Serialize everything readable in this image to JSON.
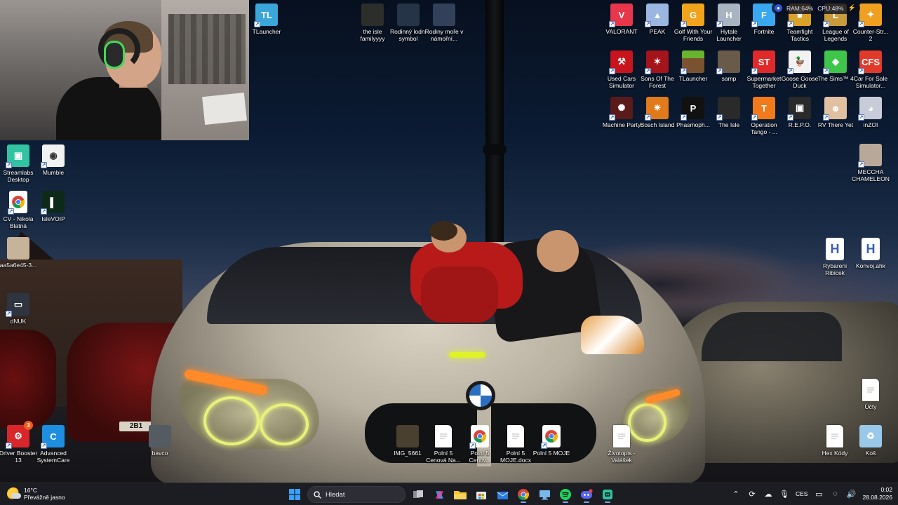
{
  "desktop": {
    "left_icons": [
      {
        "label": "Streamlabs Desktop",
        "icon": "streamlabs-icon",
        "color": "#31c3a2"
      },
      {
        "label": "Mumble",
        "icon": "mumble-icon",
        "color": "#f2f2f2"
      },
      {
        "label": "CV - Nikola Blatná",
        "icon": "chrome-icon",
        "color": "#ffffff"
      },
      {
        "label": "IsleVOIP",
        "icon": "islevoip-icon",
        "color": "#0d2a18"
      },
      {
        "label": "aa5a6e45-3...",
        "icon": "image-file-icon",
        "color": "#c7b39a"
      },
      {
        "label": "dNUK",
        "icon": "dnuk-icon",
        "color": "#2e3440"
      },
      {
        "label": "Driver Booster 13",
        "icon": "driver-booster-icon",
        "color": "#d8262b",
        "badge": "3"
      },
      {
        "label": "Advanced SystemCare",
        "icon": "advanced-systemcare-icon",
        "color": "#1e8fe0"
      },
      {
        "label": "bavco",
        "icon": "image-file-icon",
        "color": "#555b63"
      }
    ],
    "top_icons": [
      {
        "label": "TLauncher",
        "icon": "tlauncher-icon",
        "color": "#3aa6d9"
      },
      {
        "label": "the isle familyyyy",
        "icon": "the-isle-image-icon",
        "color": "#2b2e2a"
      },
      {
        "label": "Rodinný lodní symbol",
        "icon": "image-file-icon",
        "color": "#263448"
      },
      {
        "label": "Rodiny moře v námořní...",
        "icon": "image-file-icon",
        "color": "#32405a"
      }
    ],
    "right_icons": [
      {
        "label": "VALORANT",
        "icon": "valorant-icon",
        "color": "#e8374a"
      },
      {
        "label": "PEAK",
        "icon": "peak-icon",
        "color": "#9bb6e0"
      },
      {
        "label": "Golf With Your Friends",
        "icon": "golf-icon",
        "color": "#f2a31c"
      },
      {
        "label": "Hytale Launcher",
        "icon": "hytale-icon",
        "color": "#a8b5c0"
      },
      {
        "label": "Fortnite",
        "icon": "fortnite-icon",
        "color": "#38a8f0"
      },
      {
        "label": "Teamfight Tactics",
        "icon": "tft-icon",
        "color": "#d9a22a"
      },
      {
        "label": "League of Legends",
        "icon": "lol-icon",
        "color": "#c89b3c"
      },
      {
        "label": "Counter-Str... 2",
        "icon": "cs2-icon",
        "color": "#f0a020"
      },
      {
        "label": "Used Cars Simulator",
        "icon": "used-cars-icon",
        "color": "#c8141c"
      },
      {
        "label": "Sons Of The Forest",
        "icon": "sons-forest-icon",
        "color": "#a5141a"
      },
      {
        "label": "TLauncher",
        "icon": "minecraft-block-icon",
        "color": "#5a9a2a"
      },
      {
        "label": "samp",
        "icon": "samp-icon",
        "color": "#6a5a4a"
      },
      {
        "label": "Supermarket Together",
        "icon": "supermarket-icon",
        "color": "#e02a2a"
      },
      {
        "label": "Goose Goose Duck",
        "icon": "goose-icon",
        "color": "#f2f2f2"
      },
      {
        "label": "The Sims™ 4",
        "icon": "sims-icon",
        "color": "#3ec54a"
      },
      {
        "label": "Car For Sale Simulator...",
        "icon": "car-for-sale-icon",
        "color": "#e23a2a"
      },
      {
        "label": "Machine Party",
        "icon": "machine-party-icon",
        "color": "#5a1a1a"
      },
      {
        "label": "Bosch Island",
        "icon": "bosch-island-icon",
        "color": "#e07a1a"
      },
      {
        "label": "Phasmoph...",
        "icon": "phasmophobia-icon",
        "color": "#111111"
      },
      {
        "label": "The Isle",
        "icon": "the-isle-icon",
        "color": "#2a2a2a"
      },
      {
        "label": "Operation Tango - ...",
        "icon": "operation-tango-icon",
        "color": "#f27a1a"
      },
      {
        "label": "R.E.P.O.",
        "icon": "repo-icon",
        "color": "#2a2a2a"
      },
      {
        "label": "RV There Yet",
        "icon": "rv-there-yet-icon",
        "color": "#e0c0a0"
      },
      {
        "label": "inZOI",
        "icon": "inzoi-icon",
        "color": "#c8ccd8"
      },
      {
        "label": "MECCHA CHAMELEON",
        "icon": "meccha-chameleon-icon",
        "color": "#b8a89a"
      },
      {
        "label": "Rybareni Ribicek",
        "icon": "ahk-script-icon",
        "color": "#ffffff"
      },
      {
        "label": "Konvoj.ahk",
        "icon": "ahk-script-icon",
        "color": "#ffffff"
      },
      {
        "label": "Účty",
        "icon": "text-file-icon",
        "color": "#ffffff"
      },
      {
        "label": "Hex Kódy",
        "icon": "text-file-icon",
        "color": "#ffffff"
      },
      {
        "label": "Koš",
        "icon": "recycle-bin-icon",
        "color": "#9ac8e8"
      }
    ],
    "bottom_icons": [
      {
        "label": "IMG_5661",
        "icon": "image-file-icon",
        "color": "#4a4030"
      },
      {
        "label": "Polní 5 Cenová Na...",
        "icon": "document-icon",
        "color": "#ffffff"
      },
      {
        "label": "Polní 5 Cenov...",
        "icon": "chrome-icon",
        "color": "#ffffff"
      },
      {
        "label": "Polní 5 MOJE.docx",
        "icon": "document-icon",
        "color": "#ffffff"
      },
      {
        "label": "Polní 5 MOJE",
        "icon": "chrome-icon",
        "color": "#ffffff"
      },
      {
        "label": "Životopis - Valášek",
        "icon": "document-icon",
        "color": "#ffffff"
      }
    ]
  },
  "wallpaper": {
    "plate_text": "2B1"
  },
  "sysmon": {
    "ram": "RAM:64%",
    "cpu": "CPU:48%"
  },
  "taskbar": {
    "weather_temp": "16°C",
    "weather_desc": "Převážně jasno",
    "search_placeholder": "Hledat",
    "language": "CES",
    "time": "0:02",
    "date": "28.08.2026",
    "apps": [
      {
        "icon": "windows-start-icon",
        "color": "#3aa0ff"
      },
      {
        "icon": "search-icon",
        "color": "#ffffff"
      },
      {
        "icon": "task-view-icon",
        "color": "#c8c8d0"
      },
      {
        "icon": "copilot-icon",
        "color": "#8a5cf0"
      },
      {
        "icon": "file-explorer-icon",
        "color": "#f2c232"
      },
      {
        "icon": "microsoft-store-icon",
        "color": "#ffffff"
      },
      {
        "icon": "mail-icon",
        "color": "#2a7ae0"
      },
      {
        "icon": "chrome-icon",
        "color": "#ffffff"
      },
      {
        "icon": "remote-desktop-icon",
        "color": "#7ab8e8"
      },
      {
        "icon": "spotify-icon",
        "color": "#1ed760"
      },
      {
        "icon": "discord-icon",
        "color": "#5865f2"
      },
      {
        "icon": "streamlabs-icon",
        "color": "#31c3a2"
      }
    ]
  }
}
